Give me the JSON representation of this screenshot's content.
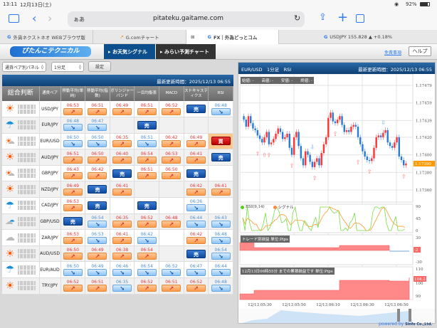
{
  "status": {
    "time": "13:11",
    "date": "12月13日(土)",
    "battery": "92%"
  },
  "browser": {
    "aa": "ぁあ",
    "url": "pitateku.gaitame.com",
    "tabs": [
      {
        "label": "外貨ネクストネオ WEBブラウザ版"
      },
      {
        "label": "G.comチャート"
      },
      {
        "label": "FX｜外為どっとコム"
      },
      {
        "label": "USDJPY 155.828 ▲ +0.18%"
      }
    ]
  },
  "site": {
    "logo": "ぴたんこテクニカル",
    "nav": [
      {
        "label": "お天気シグナル"
      },
      {
        "label": "みらい予測チャート"
      }
    ],
    "disclaimer": "免責事項",
    "help": "ヘルプ"
  },
  "controls": {
    "panel_select": "通貨ペア別パネル",
    "timeframe_select": "1分足",
    "settings": "設定"
  },
  "left": {
    "updated": "最新更新時間：2025/12/13 06:55",
    "headers": [
      "総合判断",
      "通貨ペア",
      "移動平均(単純)",
      "移動平均(指数)",
      "ボリンジャーバンド",
      "一目均衡表",
      "MACD",
      "ストキャスティクス",
      "RSI"
    ],
    "sell": "売",
    "buy": "買",
    "rows": [
      {
        "pair": "USD/JPY",
        "weather": "sun",
        "o": 5,
        "b": 1,
        "cells": [
          [
            "up",
            "06:53"
          ],
          [
            "up",
            "06:51"
          ],
          [
            "up",
            "06:49"
          ],
          [
            "up",
            "06:51"
          ],
          [
            "up",
            "06:52"
          ],
          [
            "sell",
            ""
          ],
          [
            "dn",
            "06:48"
          ]
        ]
      },
      {
        "pair": "EUR/JPY",
        "weather": "rain",
        "o": 0,
        "b": 5,
        "cells": [
          [
            "dn",
            "06:48"
          ],
          [
            "dn",
            "06:47"
          ],
          [
            "",
            ""
          ],
          [
            "sell",
            ""
          ],
          [
            "",
            ""
          ],
          [
            "",
            ""
          ],
          [
            "",
            ""
          ]
        ]
      },
      {
        "pair": "EUR/USD",
        "weather": "suncloud",
        "o": 2,
        "b": 4,
        "cells": [
          [
            "dn",
            "06:50"
          ],
          [
            "dn",
            "06:50"
          ],
          [
            "up",
            "06:35"
          ],
          [
            "dn",
            "06:51"
          ],
          [
            "up",
            "06:42"
          ],
          [
            "up",
            "06:49"
          ],
          [
            "buy",
            ""
          ]
        ]
      },
      {
        "pair": "AUD/JPY",
        "weather": "sun",
        "o": 7,
        "b": 1,
        "cells": [
          [
            "up",
            "06:51"
          ],
          [
            "up",
            "06:50"
          ],
          [
            "up",
            "06:40"
          ],
          [
            "up",
            "06:54"
          ],
          [
            "up",
            "06:53"
          ],
          [
            "up",
            "06:41"
          ],
          [
            "sell",
            ""
          ]
        ]
      },
      {
        "pair": "GBP/JPY",
        "weather": "suncloud",
        "o": 4,
        "b": 3,
        "cells": [
          [
            "up",
            "06:43"
          ],
          [
            "up",
            "06:42"
          ],
          [
            "sell",
            ""
          ],
          [
            "up",
            "06:51"
          ],
          [
            "up",
            "06:50"
          ],
          [
            "sell",
            ""
          ],
          [
            "",
            ""
          ]
        ]
      },
      {
        "pair": "NZD/JPY",
        "weather": "sun",
        "o": 4,
        "b": 1,
        "cells": [
          [
            "up",
            "06:49"
          ],
          [
            "sell",
            ""
          ],
          [
            "up",
            "06:41"
          ],
          [
            "",
            ""
          ],
          [
            "",
            ""
          ],
          [
            "up",
            "06:42"
          ],
          [
            "up",
            "06:41"
          ]
        ]
      },
      {
        "pair": "CAD/JPY",
        "weather": "rain",
        "o": 1,
        "b": 4,
        "cells": [
          [
            "up",
            "06:53"
          ],
          [
            "sell",
            ""
          ],
          [
            "",
            ""
          ],
          [
            "sell",
            ""
          ],
          [
            "",
            ""
          ],
          [
            "dn",
            "06:36"
          ],
          [
            "",
            ""
          ]
        ]
      },
      {
        "pair": "GBP/USD",
        "weather": "cloudrain",
        "o": 3,
        "b": 5,
        "cells": [
          [
            "sell",
            ""
          ],
          [
            "dn",
            "06:54"
          ],
          [
            "up",
            "06:35"
          ],
          [
            "up",
            "06:52"
          ],
          [
            "up",
            "06:48"
          ],
          [
            "dn",
            "06:44"
          ],
          [
            "dn",
            "06:43"
          ]
        ]
      },
      {
        "pair": "ZAR/JPY",
        "weather": "cloud",
        "o": 3,
        "b": 3,
        "cells": [
          [
            "up",
            "06:53"
          ],
          [
            "dn",
            "06:53"
          ],
          [
            "up",
            "06:41"
          ],
          [
            "dn",
            "06:42"
          ],
          [
            "",
            ""
          ],
          [
            "up",
            "06:42"
          ],
          [
            "dn",
            "06:48"
          ]
        ]
      },
      {
        "pair": "AUD/USD",
        "weather": "sun",
        "o": 4,
        "b": 2,
        "cells": [
          [
            "up",
            "06:50"
          ],
          [
            "up",
            "06:49"
          ],
          [
            "up",
            "06:38"
          ],
          [
            "up",
            "06:54"
          ],
          [
            "",
            ""
          ],
          [
            "sell",
            ""
          ],
          [
            "dn",
            "06:54"
          ]
        ]
      },
      {
        "pair": "EUR/AUD",
        "weather": "rain",
        "o": 0,
        "b": 7,
        "cells": [
          [
            "dn",
            "06:50"
          ],
          [
            "dn",
            "06:49"
          ],
          [
            "dn",
            "06:46"
          ],
          [
            "dn",
            "06:54"
          ],
          [
            "dn",
            "06:52"
          ],
          [
            "dn",
            "06:47"
          ],
          [
            "dn",
            "06:44"
          ]
        ]
      },
      {
        "pair": "TRY/JPY",
        "weather": "sun",
        "o": 5,
        "b": 1,
        "cells": [
          [
            "up",
            "06:52"
          ],
          [
            "up",
            "06:51"
          ],
          [
            "dn",
            "06:35"
          ],
          [
            "up",
            "06:52"
          ],
          [
            "up",
            "06:51"
          ],
          [
            "up",
            "06:52"
          ],
          [
            "dn",
            "06:48"
          ]
        ]
      }
    ]
  },
  "chart": {
    "title": "EUR/USD　1分足　RSI",
    "updated": "最新更新時間：2025/12/13 06:55",
    "ohlc_label": "始値: -　　高値: -　　安値: -　　終値: -",
    "yticks": [
      "1.17479",
      "1.17459",
      "1.17439",
      "1.17420",
      "1.17400",
      "1.17380",
      "1.17360"
    ],
    "current_price": "1.17390",
    "closes": [
      1.1744,
      1.17432,
      1.17444,
      1.17436,
      1.1743,
      1.17428,
      1.17422,
      1.17418,
      1.17414,
      1.1742,
      1.17426,
      1.17412,
      1.17414,
      1.17418,
      1.17424,
      1.1743,
      1.17426,
      1.17418,
      1.1742,
      1.17424,
      1.17408,
      1.174,
      1.1742,
      1.17426,
      1.1741,
      1.17396,
      1.17388,
      1.17404,
      1.174,
      1.17392,
      1.17386,
      1.17392,
      1.17396,
      1.17388,
      1.17402,
      1.17412,
      1.1742,
      1.17442,
      1.17448,
      1.17438,
      1.17436,
      1.1744,
      1.17444,
      1.17434,
      1.17426,
      1.17428,
      1.17426,
      1.17432,
      1.17434,
      1.17432,
      1.1742,
      1.17412,
      1.17404,
      1.17398,
      1.17394,
      1.17393,
      1.17396,
      1.17408,
      1.1742,
      1.17422,
      1.1742,
      1.17425,
      1.17428,
      1.17414,
      1.1741,
      1.17408,
      1.17414,
      1.1742,
      1.17398,
      1.17394,
      1.17388,
      1.1739
    ],
    "buy_signals": [
      9,
      13,
      15,
      30,
      44,
      57,
      70,
      78,
      98
    ],
    "sell_signals": [
      42,
      86
    ],
    "rsi_legend": "RSI(9,14)",
    "signal_legend": "シグナル",
    "rsi_ticks": [
      "90",
      "45",
      "0"
    ],
    "trade_label": "トレード別損益 単位:Pips",
    "trade_ticks": [
      "30",
      "-30"
    ],
    "trade_value": "-2",
    "cum_label": "12月13日06時55分 までの累積損益です 単位:Pips",
    "cum_ticks": [
      "110",
      "100",
      "90"
    ],
    "cum_value": "104.2",
    "xticks": [
      "12/13 05:30",
      "12/13 05:50",
      "12/13 06:10",
      "12/13 06:30",
      "12/13 06:50"
    ],
    "powered": "powered by",
    "company": "Sinfo Co.,Ltd."
  }
}
